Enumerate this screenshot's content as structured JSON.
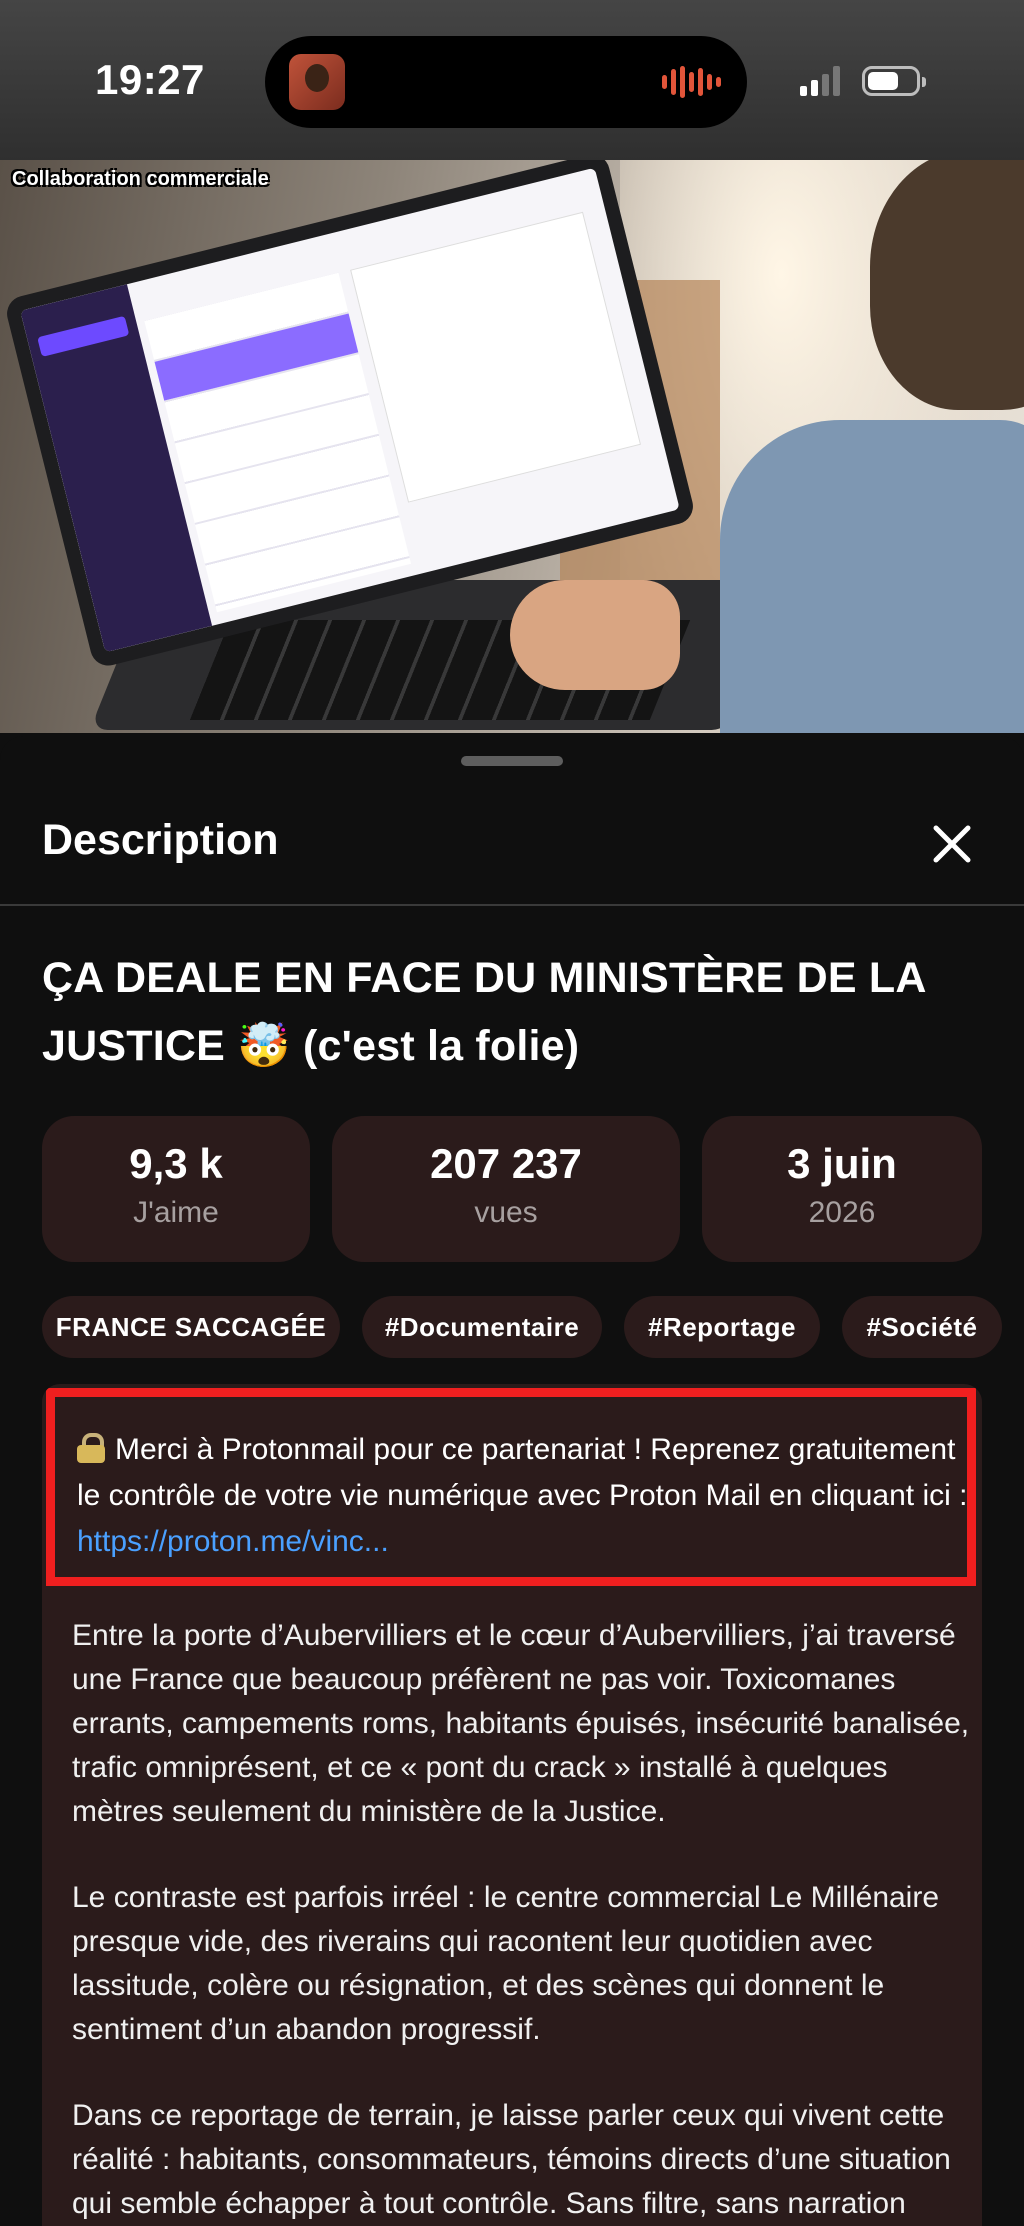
{
  "status_bar": {
    "time": "19:27"
  },
  "video": {
    "overlay_label": "Collaboration commerciale"
  },
  "sheet": {
    "title": "Description",
    "video_title": "ÇA DEALE EN FACE DU MINISTÈRE DE LA JUSTICE 🤯 (c'est la folie)",
    "stats": [
      {
        "value": "9,3 k",
        "label": "J'aime"
      },
      {
        "value": "207 237",
        "label": "vues"
      },
      {
        "value": "3 juin",
        "label": "2026"
      }
    ],
    "tags": [
      "FRANCE SACCAGÉE",
      "#Documentaire",
      "#Reportage",
      "#Société"
    ],
    "promo": {
      "text": "Merci à Protonmail pour ce partenariat ! Reprenez gratuitement le contrôle de votre vie numérique avec Proton Mail en cliquant ici : ",
      "link": "https://proton.me/vinc...",
      "highlight_color": "#f01f1f"
    },
    "paragraphs": [
      "Entre la porte d’Aubervilliers et le cœur d’Aubervilliers, j’ai traversé une France que beaucoup préfèrent ne pas voir. Toxicomanes errants, campements roms, habitants épuisés, insécurité banalisée, trafic omniprésent, et ce « pont du crack » installé à quelques mètres seulement du ministère de la Justice.",
      "Le contraste est parfois irréel : le centre commercial Le Millénaire presque vide, des riverains qui racontent leur quotidien avec lassitude, colère ou résignation, et des scènes qui donnent le sentiment d’un abandon progressif.",
      "Dans ce reportage de terrain, je laisse parler ceux qui vivent cette réalité : habitants, consommateurs, témoins directs d’une situation qui semble échapper à tout contrôle. Sans filtre, sans narration artificielle, simplement la réalité telle qu’elle apparaît."
    ]
  },
  "colors": {
    "background": "#0f0f0f",
    "card": "#2b1b1b",
    "link": "#4aa0ff"
  }
}
